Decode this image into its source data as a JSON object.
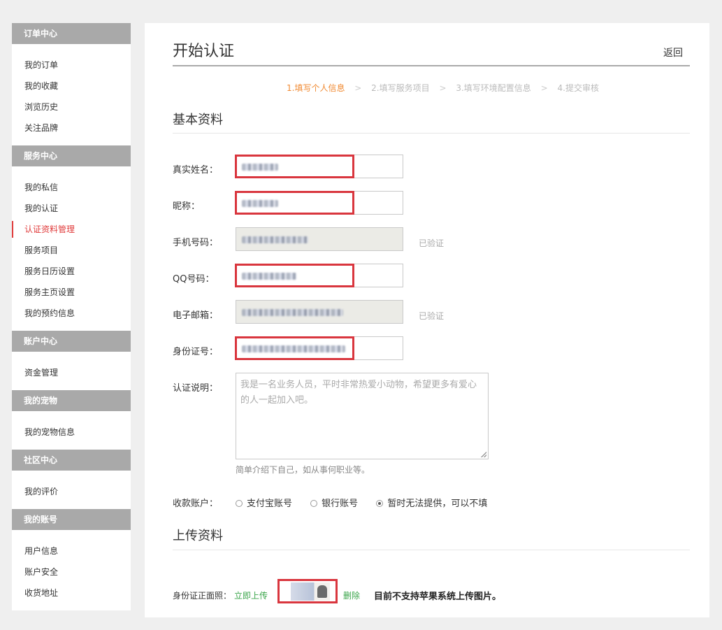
{
  "sidebar": {
    "sections": [
      {
        "title": "订单中心",
        "items": [
          "我的订单",
          "我的收藏",
          "浏览历史",
          "关注品牌"
        ]
      },
      {
        "title": "服务中心",
        "items": [
          "我的私信",
          "我的认证",
          "认证资料管理",
          "服务项目",
          "服务日历设置",
          "服务主页设置",
          "我的预约信息"
        ]
      },
      {
        "title": "账户中心",
        "items": [
          "资金管理"
        ]
      },
      {
        "title": "我的宠物",
        "items": [
          "我的宠物信息"
        ]
      },
      {
        "title": "社区中心",
        "items": [
          "我的评价"
        ]
      },
      {
        "title": "我的账号",
        "items": [
          "用户信息",
          "账户安全",
          "收货地址"
        ]
      }
    ],
    "active_item": "认证资料管理",
    "accent_color": "#e03c3c"
  },
  "header": {
    "title": "开始认证",
    "back_label": "返回"
  },
  "steps": {
    "items": [
      "1.填写个人信息",
      "2.填写服务项目",
      "3.填写环境配置信息",
      "4.提交审核"
    ],
    "separator": ">",
    "active_index": 0,
    "active_color": "#f08a32"
  },
  "basic": {
    "section_title": "基本资料",
    "real_name_label": "真实姓名：",
    "nickname_label": "昵称：",
    "phone_label": "手机号码：",
    "phone_status": "已验证",
    "qq_label": "QQ号码：",
    "email_label": "电子邮箱：",
    "email_status": "已验证",
    "id_label": "身份证号：",
    "desc_label": "认证说明：",
    "desc_placeholder": "我是一名业务人员，平时非常热爱小动物，希望更多有爱心的人一起加入吧。",
    "desc_hint": "简单介绍下自己，如从事何职业等。",
    "account_label": "收款账户：",
    "account_options": [
      "支付宝账号",
      "银行账号",
      "暂时无法提供，可以不填"
    ],
    "account_selected": 2
  },
  "upload": {
    "section_title": "上传资料",
    "id_front_label": "身份证正面照：",
    "upload_now": "立即上传",
    "delete": "删除",
    "note": "目前不支持苹果系统上传图片。",
    "link_color": "#3aa54a"
  },
  "highlight_color": "#d9363e"
}
